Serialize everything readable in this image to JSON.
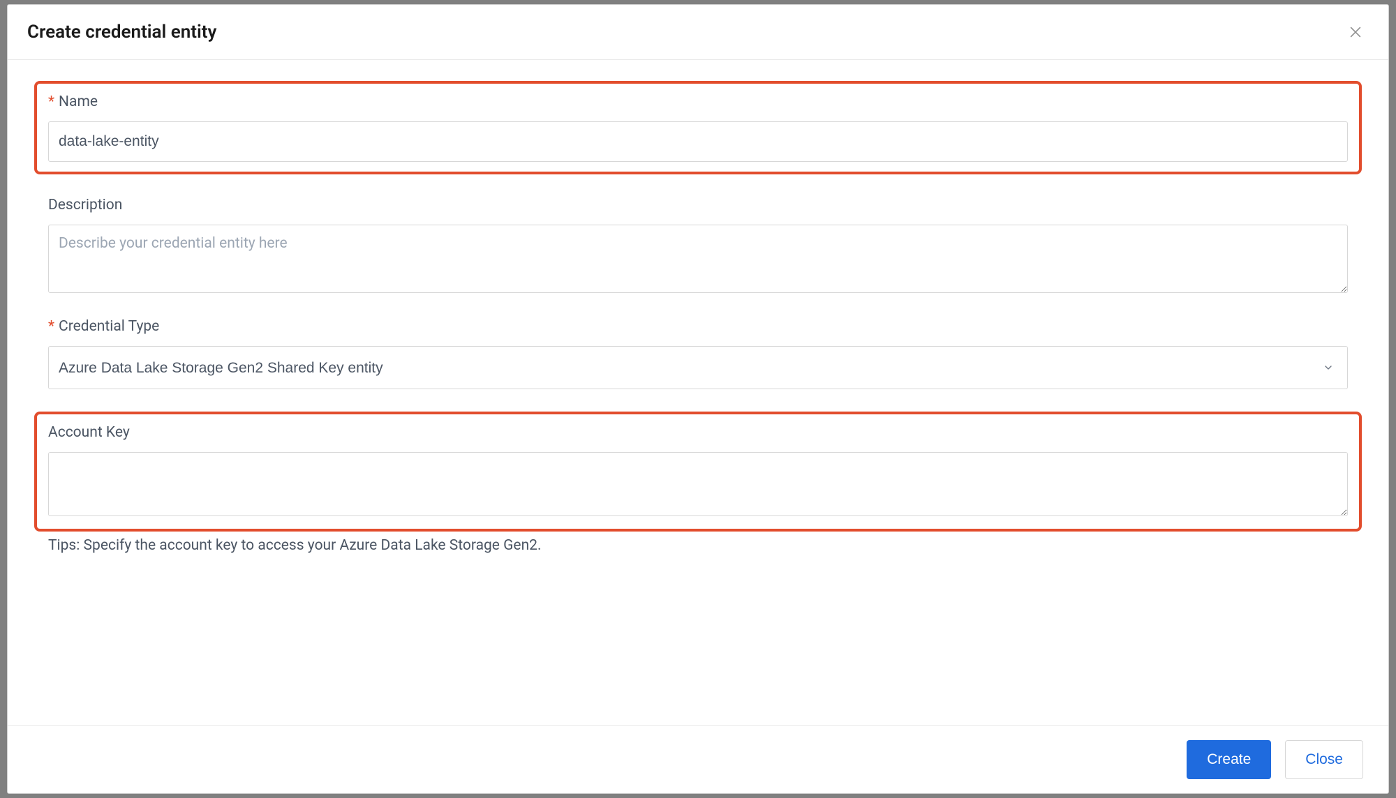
{
  "header": {
    "title": "Create credential entity"
  },
  "form": {
    "name": {
      "label": "Name",
      "value": "data-lake-entity"
    },
    "description": {
      "label": "Description",
      "placeholder": "Describe your credential entity here",
      "value": ""
    },
    "credentialType": {
      "label": "Credential Type",
      "selected": "Azure Data Lake Storage Gen2 Shared Key entity"
    },
    "accountKey": {
      "label": "Account Key",
      "value": "",
      "tips": "Tips: Specify the account key to access your Azure Data Lake Storage Gen2."
    }
  },
  "footer": {
    "create": "Create",
    "close": "Close"
  }
}
